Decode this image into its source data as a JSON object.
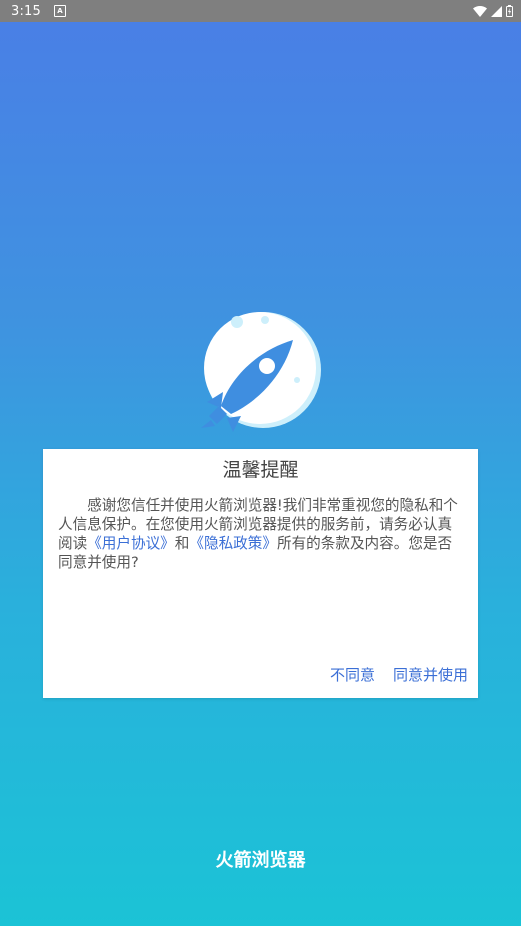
{
  "status_bar": {
    "time": "3:15",
    "notification_icon": "A",
    "icons": [
      "wifi-icon",
      "signal-icon",
      "battery-icon"
    ]
  },
  "logo": {
    "icon": "rocket-moon-icon"
  },
  "dialog": {
    "title": "温馨提醒",
    "body": {
      "intro": "感谢您信任并使用火箭浏览器!我们非常重视您的隐私和个人信息保护。在您使用火箭浏览器提供的服务前，请务必认真阅读",
      "link_user_agreement": "《用户协议》",
      "and": "和",
      "link_privacy_policy": "《隐私政策》",
      "outro": "所有的条款及内容。您是否同意并使用?"
    },
    "actions": {
      "disagree": "不同意",
      "agree": "同意并使用"
    }
  },
  "footer": {
    "app_name": "火箭浏览器"
  },
  "colors": {
    "gradient_top": "#4a7ee6",
    "gradient_bottom": "#1bc3d6",
    "link": "#3b6fd6",
    "status_bar": "#7f7f7f"
  }
}
